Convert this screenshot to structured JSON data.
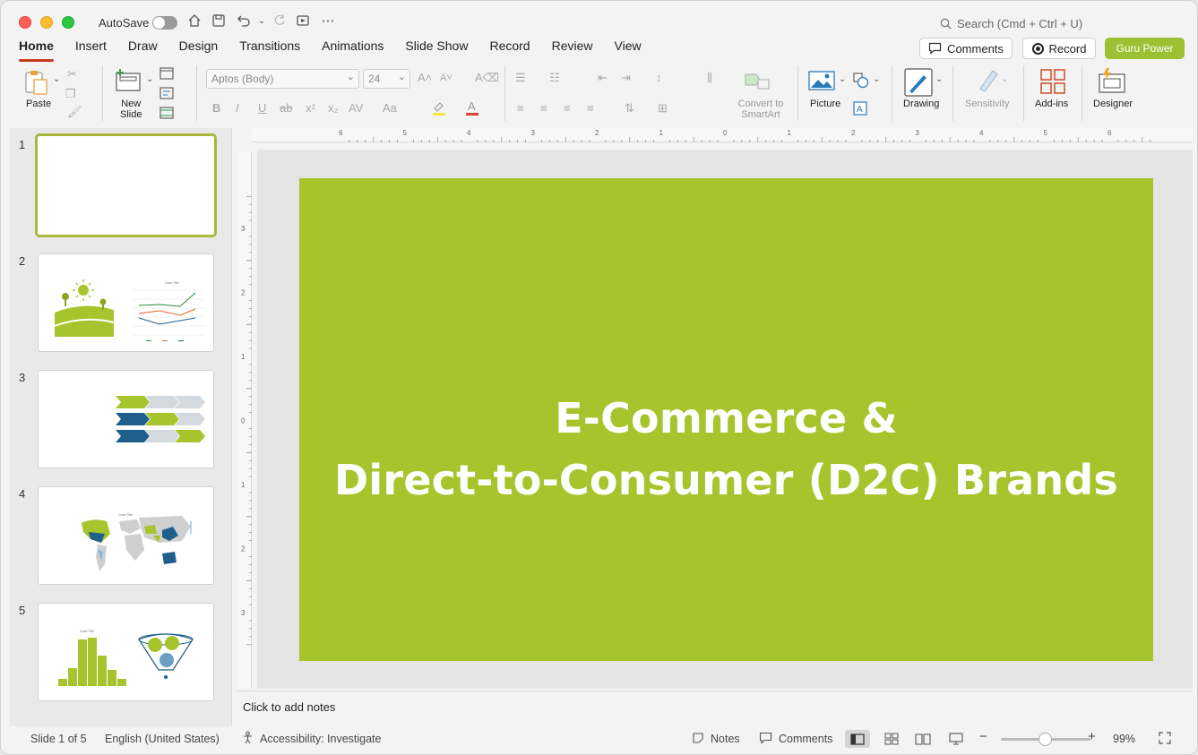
{
  "titlebar": {
    "autosave_label": "AutoSave",
    "search_placeholder": "Search (Cmd + Ctrl + U)"
  },
  "tabs": [
    {
      "label": "Home",
      "active": true
    },
    {
      "label": "Insert"
    },
    {
      "label": "Draw"
    },
    {
      "label": "Design"
    },
    {
      "label": "Transitions"
    },
    {
      "label": "Animations"
    },
    {
      "label": "Slide Show"
    },
    {
      "label": "Record"
    },
    {
      "label": "Review"
    },
    {
      "label": "View"
    }
  ],
  "actions": {
    "comments_label": "Comments",
    "record_label": "Record",
    "guru_label": "Guru Power",
    "guru_color": "#9bc133"
  },
  "ribbon": {
    "paste_label": "Paste",
    "new_slide_label": "New\nSlide",
    "font_name": "Aptos (Body)",
    "font_size": "24",
    "convert_label": "Convert to SmartArt",
    "picture_label": "Picture",
    "drawing_label": "Drawing",
    "sensitivity_label": "Sensitivity",
    "addins_label": "Add-ins",
    "designer_label": "Designer"
  },
  "slides": [
    {
      "number": "1",
      "selected": true
    },
    {
      "number": "2",
      "chart_title": "Chart Title"
    },
    {
      "number": "3"
    },
    {
      "number": "4",
      "chart_title": "Chart Title"
    },
    {
      "number": "5",
      "chart_title": "Chart Title"
    }
  ],
  "slide": {
    "title_line1": "E-Commerce &",
    "title_line2": "Direct-to-Consumer (D2C) Brands",
    "background": "#a8c42c"
  },
  "notes_placeholder": "Click to add notes",
  "status": {
    "slide_counter": "Slide 1 of 5",
    "language": "English (United States)",
    "accessibility": "Accessibility: Investigate",
    "notes_label": "Notes",
    "comments_label": "Comments",
    "zoom": "99%"
  },
  "ruler": {
    "h_labels": [
      "6",
      "5",
      "4",
      "3",
      "2",
      "1",
      "0",
      "1",
      "2",
      "3",
      "4",
      "5",
      "6"
    ],
    "v_labels": [
      "3",
      "2",
      "1",
      "0",
      "1",
      "2",
      "3"
    ]
  }
}
